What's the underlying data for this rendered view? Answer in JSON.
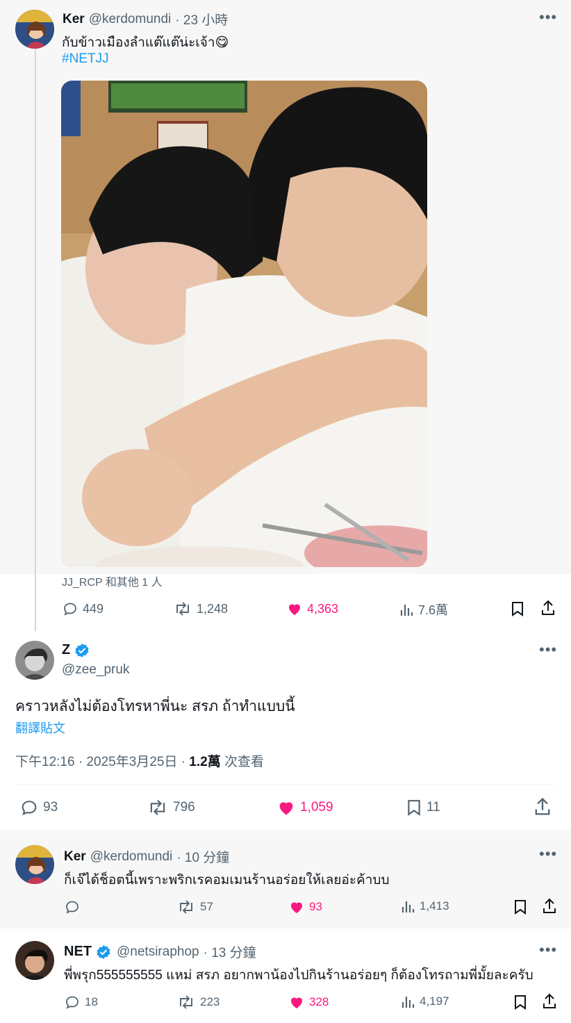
{
  "parent": {
    "name": "Ker",
    "handle": "@kerdomundi",
    "time": "· 23 小時",
    "text": "กับข้าวเมืองลำแต๊แต๊น่ะเจ้า😋",
    "hashtag": "#NETJJ",
    "tagged": "JJ_RCP 和其他 1 人",
    "replies": "449",
    "retweets": "1,248",
    "likes": "4,363",
    "views": "7.6萬"
  },
  "main": {
    "name": "Z",
    "handle": "@zee_pruk",
    "text": "คราวหลังไม่ต้องโทรหาพี่นะ สรภ ถ้าทำแบบนี้",
    "translate": "翻譯貼文",
    "timestamp": "下午12:16 · 2025年3月25日 · ",
    "views_count": "1.2萬",
    "views_label": " 次查看",
    "replies": "93",
    "retweets": "796",
    "likes": "1,059",
    "bookmarks": "11"
  },
  "replies": [
    {
      "name": "Ker",
      "handle": "@kerdomundi",
      "time": "· 10 分鐘",
      "text": "ก็เจ๊ได้ช็อตนี้เพราะพริกเรคอมเมนร้านอร่อยให้เลยอ่ะค้าบบ",
      "replies": "",
      "retweets": "57",
      "likes": "93",
      "views": "1,413"
    },
    {
      "name": "NET",
      "handle": "@netsiraphop",
      "time": "· 13 分鐘",
      "text": "พี่พรุก555555555 แหม่ สรภ อยากพาน้องไปกินร้านอร่อยๆ ก็ต้องโทรถามพี่มั้ยละครับ",
      "replies": "18",
      "retweets": "223",
      "likes": "328",
      "views": "4,197"
    }
  ],
  "colors": {
    "accent": "#1d9bf0",
    "like": "#f91880",
    "muted": "#536471"
  }
}
